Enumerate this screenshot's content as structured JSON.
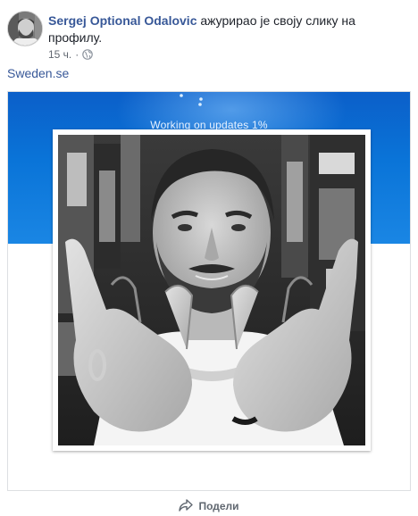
{
  "post": {
    "author": "Sergej Optional Odalovic",
    "action": " ажурирао је своју слику на профилу.",
    "time": "15 ч.",
    "separator": "·",
    "privacy_icon": "globe-icon"
  },
  "link": {
    "text": "Sweden.se"
  },
  "cover": {
    "status_text": "Working on updates  1%"
  },
  "share": {
    "label": "Подели",
    "icon": "share-icon"
  },
  "colors": {
    "link_blue": "#385898",
    "cover_blue": "#0a74d8",
    "muted": "#606770"
  }
}
